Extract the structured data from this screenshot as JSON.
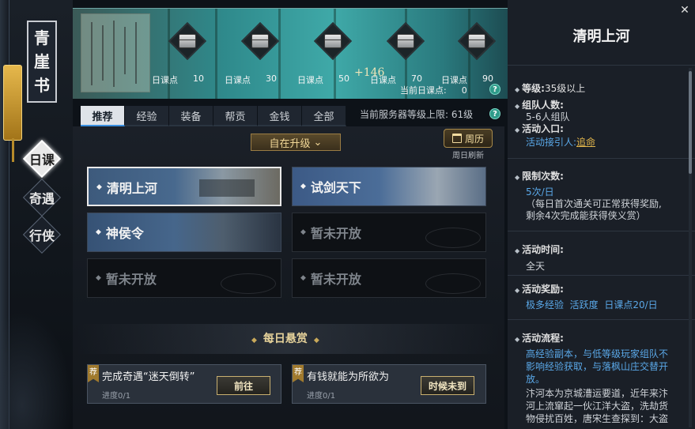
{
  "book": {
    "title_chars": [
      "青",
      "崖",
      "书"
    ]
  },
  "side_tabs": [
    {
      "label": "日课",
      "active": true
    },
    {
      "label": "奇遇",
      "active": false
    },
    {
      "label": "行侠",
      "active": false
    }
  ],
  "milestones": [
    {
      "label": "日课点",
      "value": "10"
    },
    {
      "label": "日课点",
      "value": "30"
    },
    {
      "label": "日课点",
      "value": "50"
    },
    {
      "label": "日课点",
      "value": "70"
    },
    {
      "label": "日课点",
      "value": "90"
    }
  ],
  "header": {
    "bonus": "+146",
    "current_points_label": "当前日课点:",
    "current_points_value": "0",
    "help_glyph": "?"
  },
  "tabs": [
    "推荐",
    "经验",
    "装备",
    "帮贡",
    "金钱",
    "全部"
  ],
  "server_level": "当前服务器等级上限: 61级",
  "filter": {
    "selected": "自在升级",
    "arrow": "⌄"
  },
  "calendar": {
    "label": "周历",
    "sub": "周日刷新"
  },
  "activities": [
    {
      "title": "清明上河",
      "selected": true,
      "locked": false
    },
    {
      "title": "试剑天下",
      "selected": false,
      "locked": false
    },
    {
      "title": "神侯令",
      "selected": false,
      "locked": false
    },
    {
      "title": "暂未开放",
      "selected": false,
      "locked": true
    },
    {
      "title": "暂未开放",
      "selected": false,
      "locked": true
    },
    {
      "title": "暂未开放",
      "selected": false,
      "locked": true
    }
  ],
  "bounty": {
    "title": "每日悬赏",
    "items": [
      {
        "tag": "荐",
        "name": "完成奇遇“迷天倒转”",
        "progress": "进度0/1",
        "button": "前往"
      },
      {
        "tag": "荐",
        "name": "有钱就能为所欲为",
        "progress": "进度0/1",
        "button": "时候未到"
      }
    ]
  },
  "detail": {
    "title": "清明上河",
    "close": "✕",
    "level_label": "等级:",
    "level_value": "35级以上",
    "team_label": "组队人数:",
    "team_value": "5-6人组队",
    "entry_label": "活动入口:",
    "entry_prefix": "活动接引人:",
    "entry_npc": "追命",
    "limit_label": "限制次数:",
    "limit_value": "5次/日",
    "limit_note_1": "（每日首次通关可正常获得奖励,",
    "limit_note_2": "剩余4次完成能获得侠义赏）",
    "time_label": "活动时间:",
    "time_value": "全天",
    "reward_label": "活动奖励:",
    "reward_1": "极多经验",
    "reward_2": "活跃度",
    "reward_3": "日课点20/日",
    "flow_label": "活动流程:",
    "flow_highlight_1": "高经验副本，与低等级玩家组队不",
    "flow_highlight_2": "影响经验获取，与落枫山庄交替开",
    "flow_highlight_3": "放。",
    "flow_text_1": "汴河本为京城漕运要道，近年来汴",
    "flow_text_2": "河上流窜起一伙江洋大盗，洗劫货",
    "flow_text_3": "物侵扰百姓，唐宋生查探到：大盗"
  },
  "colors": {
    "accent_gold": "#e2b64c",
    "link_blue": "#5aa8e8",
    "banner_teal": "#3fa9a8"
  }
}
